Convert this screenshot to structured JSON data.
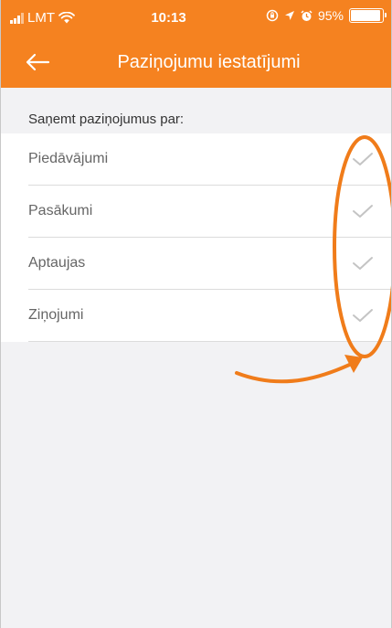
{
  "status_bar": {
    "carrier": "LMT",
    "time": "10:13",
    "battery": "95%",
    "battery_level": 0.95
  },
  "header": {
    "title": "Paziņojumu iestatījumi",
    "back_icon": "arrow-left-icon"
  },
  "section": {
    "title": "Saņemt paziņojumus par:"
  },
  "notifications": [
    {
      "label": "Piedāvājumi",
      "checked": true
    },
    {
      "label": "Pasākumi",
      "checked": true
    },
    {
      "label": "Aptaujas",
      "checked": true
    },
    {
      "label": "Ziņojumi",
      "checked": true
    }
  ],
  "colors": {
    "accent": "#f58220",
    "check": "#c4c4c4",
    "annotation": "#f07c1a"
  }
}
